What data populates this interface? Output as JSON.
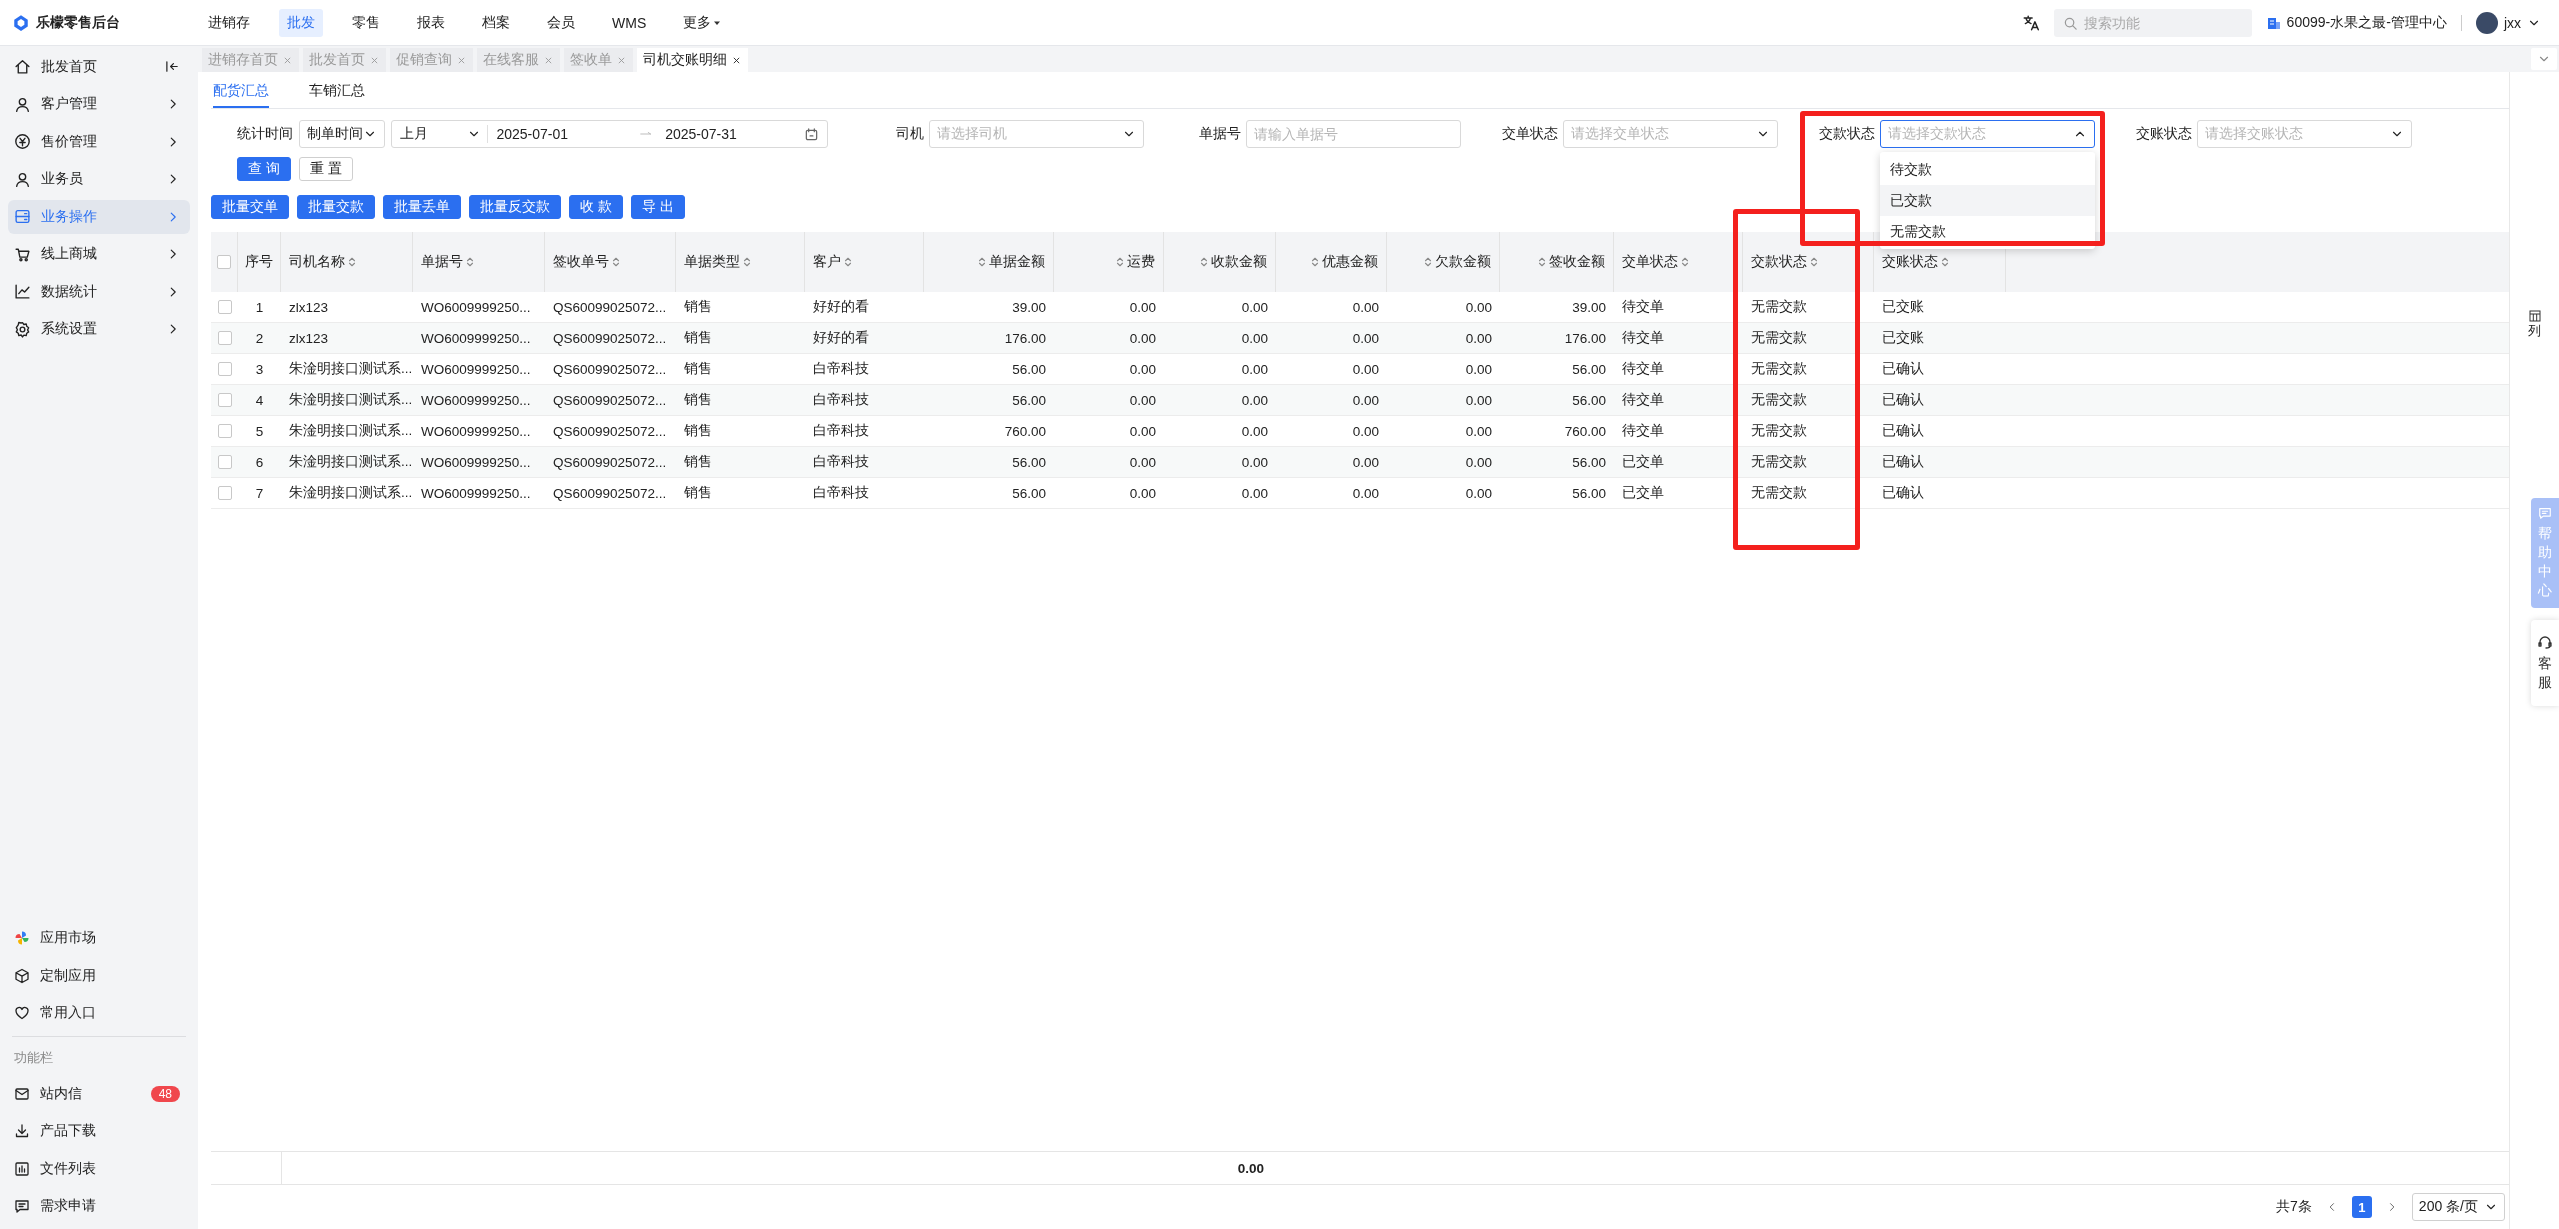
{
  "app": {
    "name": "乐檬零售后台"
  },
  "top_nav": [
    {
      "label": "进销存",
      "selected": false,
      "dropdown": false
    },
    {
      "label": "批发",
      "selected": true,
      "dropdown": false
    },
    {
      "label": "零售",
      "selected": false,
      "dropdown": false
    },
    {
      "label": "报表",
      "selected": false,
      "dropdown": false
    },
    {
      "label": "档案",
      "selected": false,
      "dropdown": false
    },
    {
      "label": "会员",
      "selected": false,
      "dropdown": false
    },
    {
      "label": "WMS",
      "selected": false,
      "dropdown": false
    },
    {
      "label": "更多",
      "selected": false,
      "dropdown": true
    }
  ],
  "search": {
    "placeholder": "搜索功能"
  },
  "store": "60099-水果之最-管理中心",
  "user": "jxx",
  "sidebar": {
    "items": [
      {
        "label": "批发首页",
        "kind": "home",
        "selected": false
      },
      {
        "label": "客户管理",
        "kind": "menu",
        "selected": false
      },
      {
        "label": "售价管理",
        "kind": "menu",
        "selected": false
      },
      {
        "label": "业务员",
        "kind": "menu",
        "selected": false
      },
      {
        "label": "业务操作",
        "kind": "menu",
        "selected": true
      },
      {
        "label": "线上商城",
        "kind": "menu",
        "selected": false
      },
      {
        "label": "数据统计",
        "kind": "menu",
        "selected": false
      },
      {
        "label": "系统设置",
        "kind": "menu",
        "selected": false
      }
    ],
    "bottom_items": [
      {
        "label": "应用市场"
      },
      {
        "label": "定制应用"
      },
      {
        "label": "常用入口"
      }
    ],
    "section_title": "功能栏",
    "function_items": [
      {
        "label": "站内信",
        "badge": "48"
      },
      {
        "label": "产品下载"
      },
      {
        "label": "文件列表"
      },
      {
        "label": "需求申请"
      }
    ]
  },
  "page_tabs": [
    {
      "label": "进销存首页",
      "selected": false
    },
    {
      "label": "批发首页",
      "selected": false
    },
    {
      "label": "促销查询",
      "selected": false
    },
    {
      "label": "在线客服",
      "selected": false
    },
    {
      "label": "签收单",
      "selected": false
    },
    {
      "label": "司机交账明细",
      "selected": true
    }
  ],
  "sub_tabs": [
    {
      "label": "配货汇总",
      "selected": true
    },
    {
      "label": "车销汇总",
      "selected": false
    }
  ],
  "time_filter": {
    "label": "统计时间",
    "time_type": "制单时间",
    "period": "上月",
    "start": "2025-07-01",
    "end": "2025-07-31"
  },
  "filters": [
    {
      "label": "司机",
      "kind": "select",
      "placeholder": "请选择司机"
    },
    {
      "label": "单据号",
      "kind": "input",
      "placeholder": "请输入单据号"
    },
    {
      "label": "交单状态",
      "kind": "select",
      "placeholder": "请选择交单状态"
    },
    {
      "label": "交款状态",
      "kind": "select",
      "placeholder": "请选择交款状态",
      "options": [
        {
          "label": "待交款",
          "highlighted": false
        },
        {
          "label": "已交款",
          "highlighted": true
        },
        {
          "label": "无需交款",
          "highlighted": false
        }
      ]
    },
    {
      "label": "交账状态",
      "kind": "select",
      "placeholder": "请选择交账状态"
    }
  ],
  "search_buttons": [
    {
      "label": "查 询",
      "kind": "primary"
    },
    {
      "label": "重 置",
      "kind": "default"
    }
  ],
  "action_buttons": [
    "批量交单",
    "批量交款",
    "批量丢单",
    "批量反交款",
    "收 款",
    "导 出"
  ],
  "table": {
    "header_checked": false,
    "columns": [
      {
        "label": "序号",
        "kind": "index",
        "sortable": false
      },
      {
        "label": "司机名称",
        "kind": "text",
        "sortable": true
      },
      {
        "label": "单据号",
        "kind": "text",
        "sortable": true
      },
      {
        "label": "签收单号",
        "kind": "text",
        "sortable": true
      },
      {
        "label": "单据类型",
        "kind": "text",
        "sortable": true
      },
      {
        "label": "客户",
        "kind": "text",
        "sortable": true
      },
      {
        "label": "单据金额",
        "kind": "number",
        "sortable": true
      },
      {
        "label": "运费",
        "kind": "number",
        "sortable": true
      },
      {
        "label": "收款金额",
        "kind": "number",
        "sortable": true
      },
      {
        "label": "优惠金额",
        "kind": "number",
        "sortable": true
      },
      {
        "label": "欠款金额",
        "kind": "number",
        "sortable": true
      },
      {
        "label": "签收金额",
        "kind": "number",
        "sortable": true
      },
      {
        "label": "交单状态",
        "kind": "text",
        "sortable": true
      },
      {
        "label": "交款状态",
        "kind": "text",
        "sortable": true
      },
      {
        "label": "交账状态",
        "kind": "text",
        "sortable": true
      }
    ],
    "rows": [
      {
        "checked": false,
        "cells": [
          "1",
          "zlx123",
          "WO6009999250...",
          "QS60099025072...",
          "销售",
          "好好的看",
          "39.00",
          "0.00",
          "0.00",
          "0.00",
          "0.00",
          "39.00",
          "待交单",
          "无需交款",
          "已交账"
        ]
      },
      {
        "checked": false,
        "cells": [
          "2",
          "zlx123",
          "WO6009999250...",
          "QS60099025072...",
          "销售",
          "好好的看",
          "176.00",
          "0.00",
          "0.00",
          "0.00",
          "0.00",
          "176.00",
          "待交单",
          "无需交款",
          "已交账"
        ]
      },
      {
        "checked": false,
        "cells": [
          "3",
          "朱淦明接口测试系...",
          "WO6009999250...",
          "QS60099025072...",
          "销售",
          "白帝科技",
          "56.00",
          "0.00",
          "0.00",
          "0.00",
          "0.00",
          "56.00",
          "待交单",
          "无需交款",
          "已确认"
        ]
      },
      {
        "checked": false,
        "cells": [
          "4",
          "朱淦明接口测试系...",
          "WO6009999250...",
          "QS60099025072...",
          "销售",
          "白帝科技",
          "56.00",
          "0.00",
          "0.00",
          "0.00",
          "0.00",
          "56.00",
          "待交单",
          "无需交款",
          "已确认"
        ]
      },
      {
        "checked": false,
        "cells": [
          "5",
          "朱淦明接口测试系...",
          "WO6009999250...",
          "QS60099025072...",
          "销售",
          "白帝科技",
          "760.00",
          "0.00",
          "0.00",
          "0.00",
          "0.00",
          "760.00",
          "待交单",
          "无需交款",
          "已确认"
        ]
      },
      {
        "checked": false,
        "cells": [
          "6",
          "朱淦明接口测试系...",
          "WO6009999250...",
          "QS60099025072...",
          "销售",
          "白帝科技",
          "56.00",
          "0.00",
          "0.00",
          "0.00",
          "0.00",
          "56.00",
          "已交单",
          "无需交款",
          "已确认"
        ]
      },
      {
        "checked": false,
        "cells": [
          "7",
          "朱淦明接口测试系...",
          "WO6009999250...",
          "QS60099025072...",
          "销售",
          "白帝科技",
          "56.00",
          "0.00",
          "0.00",
          "0.00",
          "0.00",
          "56.00",
          "已交单",
          "无需交款",
          "已确认"
        ]
      }
    ],
    "summary_total": "0.00",
    "column_settings": "列"
  },
  "pagination": {
    "total": "共7条",
    "pages": [
      {
        "label": "1",
        "selected": true
      }
    ],
    "page_size": "200 条/页"
  },
  "side_widgets": [
    {
      "label": "帮助中心",
      "kind": "help"
    },
    {
      "label": "客服",
      "kind": "service"
    }
  ]
}
